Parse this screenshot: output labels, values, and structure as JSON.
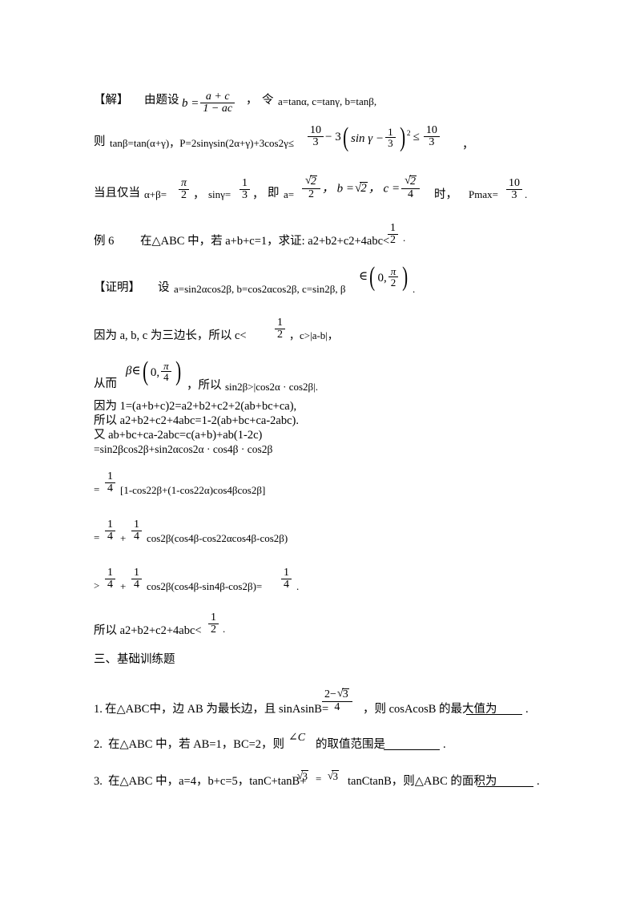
{
  "document": {
    "type": "math-worksheet-page",
    "language": "zh-CN"
  },
  "solution_block": {
    "label": "【解】",
    "lead_text": "由题设",
    "eq_b": "b =",
    "frac_b": {
      "numerator": "a + c",
      "denominator": "1 − ac"
    },
    "after_frac": "，",
    "ling": "令",
    "substitutions": "a=tanα, c=tanγ, b=tanβ,",
    "line2": {
      "prefix": "则",
      "text": "tanβ=tan(α+γ)，P=2sinγsin(2α+γ)+3cos2γ≤",
      "frac1": {
        "numerator": "10",
        "denominator": "3"
      },
      "minus3": "− 3",
      "paren_inner": "sin γ −",
      "frac_inner": {
        "numerator": "1",
        "denominator": "3"
      },
      "exponent": "2",
      "le": "≤",
      "frac2": {
        "numerator": "10",
        "denominator": "3"
      },
      "tail": "，"
    },
    "line3": {
      "prefix": "当且仅当",
      "t1": "α+β=",
      "frac_pi2": {
        "numerator": "π",
        "denominator": "2"
      },
      "t2": "，",
      "t3": "sinγ=",
      "frac_13": {
        "numerator": "1",
        "denominator": "3"
      },
      "t4": "，",
      "t5": "即",
      "t6": "a=",
      "frac_sqrt2_2": {
        "numerator": "√2",
        "denominator": "2"
      },
      "t7": "， b =",
      "sqrt2": "√2",
      "t8": "， c =",
      "frac_sqrt2_4": {
        "numerator": "√2",
        "denominator": "4"
      },
      "t9": "时，",
      "t10": "Pmax=",
      "frac_10_3": {
        "numerator": "10",
        "denominator": "3"
      },
      "t11": "."
    }
  },
  "example6": {
    "label": "例 6",
    "text": "在△ABC 中，若 a+b+c=1，求证: a2+b2+c2+4abc<",
    "frac_half": {
      "numerator": "1",
      "denominator": "2"
    },
    "tail": "."
  },
  "proof": {
    "label": "【证明】",
    "line1": {
      "she": "设",
      "text": "a=sin2αcos2β, b=cos2αcos2β, c=sin2β, β",
      "in": "∈",
      "interval": {
        "left": "0,",
        "frac": {
          "numerator": "π",
          "denominator": "2"
        }
      },
      "tail": "."
    },
    "line2": {
      "p1": "因为 a, b, c 为三边长，所以 c<",
      "frac_half": {
        "numerator": "1",
        "denominator": "2"
      },
      "p2": "，c>|a-b|，"
    },
    "line3": {
      "congEr": "从而",
      "beta": "β",
      "in": "∈",
      "interval": {
        "left": "0,",
        "frac": {
          "numerator": "π",
          "denominator": "4"
        }
      },
      "p2": "，所以",
      "p3": "sin2β>|cos2α · cos2β|."
    },
    "plain_lines": [
      "因为 1=(a+b+c)2=a2+b2+c2+2(ab+bc+ca),",
      "所以 a2+b2+c2+4abc=1-2(ab+bc+ca-2abc).",
      "又 ab+bc+ca-2abc=c(a+b)+ab(1-2c)",
      "=sin2βcos2β+sin2αcos2α · cos4β · cos2β"
    ],
    "step1": {
      "eq": "=",
      "frac": {
        "numerator": "1",
        "denominator": "4"
      },
      "text": "[1-cos22β+(1-cos22α)cos4βcos2β]"
    },
    "step2": {
      "eq": "=",
      "frac1": {
        "numerator": "1",
        "denominator": "4"
      },
      "plus": "+",
      "frac2": {
        "numerator": "1",
        "denominator": "4"
      },
      "text": "cos2β(cos4β-cos22αcos4β-cos2β)"
    },
    "step3": {
      "eq": ">",
      "frac1": {
        "numerator": "1",
        "denominator": "4"
      },
      "plus": "+",
      "frac2": {
        "numerator": "1",
        "denominator": "4"
      },
      "text": "cos2β(cos4β-sin4β-cos2β)=",
      "frac3": {
        "numerator": "1",
        "denominator": "4"
      },
      "tail": "."
    },
    "conclusion": {
      "p1": "所以 a2+b2+c2+4abc<",
      "frac_half": {
        "numerator": "1",
        "denominator": "2"
      },
      "tail": "."
    }
  },
  "section_heading": "三、基础训练题",
  "exercises": [
    {
      "number": "1.",
      "part1": "在△ABC中，边 AB 为最长边，且 sinAsinB=",
      "frac": {
        "numerator": "2−√3",
        "denominator": "4"
      },
      "part2": "，则 cosAcosB 的最大值为",
      "blank": "",
      "tail": "."
    },
    {
      "number": "2.",
      "part1": "在△ABC 中，若 AB=1，BC=2，则",
      "angle": "∠C",
      "part2": "的取值范围是",
      "blank": "",
      "tail": "."
    },
    {
      "number": "3.",
      "part1": "在△ABC 中，a=4，b+c=5，tanC+tanB+",
      "sqrt1": "√3",
      "eqsign": "=",
      "sqrt2": "√3",
      "part2": "tanCtanB，则△ABC 的面积为",
      "blank": "",
      "tail": "."
    }
  ]
}
